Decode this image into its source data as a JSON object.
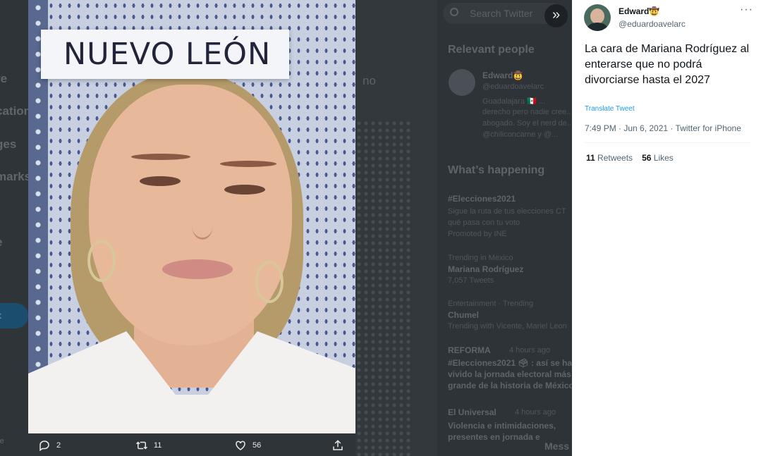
{
  "background": {
    "nav_items": [
      "re",
      "cations",
      "ges",
      "marks",
      "e"
    ],
    "tweet_button_label": "et",
    "partial_text": "no",
    "search_placeholder": "Search Twitter",
    "relevant_people_title": "Relevant people",
    "relevant_user_name": "Edward🤠",
    "relevant_user_handle": "@eduardoavelarc",
    "relevant_user_bio": [
      "Guadalajara 🇲🇽 ...",
      "derecho pero nadie cree...",
      "abogado. Soy el nerd de...",
      "@chiliconcarne y @..."
    ],
    "whats_happening_title": "What’s happening",
    "trends": [
      {
        "title": "#Elecciones2021",
        "desc": "Sigue la ruta de tus elecciones CT",
        "desc2": "qué pasa con tu voto",
        "promo": "Promoted by INE"
      },
      {
        "title": "Mariana Rodríguez",
        "context": "Trending in Mexico",
        "count": "7,057 Tweets"
      },
      {
        "title": "Chumel",
        "context": "Entertainment · Trending",
        "count": "Trending with Vicente, Mariel Leon"
      }
    ],
    "news": [
      {
        "source": "REFORMA",
        "time": "4 hours ago",
        "headline": "#Elecciones2021 🗳 : así se ha vivido la jornada electoral más grande de la historia de México"
      },
      {
        "source": "El Universal",
        "time": "4 hours ago",
        "headline": "Violencia e intimidaciones, presentes en jornada e"
      }
    ],
    "messages_label": "Mess"
  },
  "media": {
    "sign_text": "NUEVO LEÓN",
    "alt": "photo"
  },
  "media_actions": {
    "reply_count": "2",
    "retweet_count": "11",
    "like_count": "56"
  },
  "tweet": {
    "author_name": "Edward🤠",
    "author_handle": "@eduardoavelarc",
    "text": "La cara de Mariana Rodríguez al enterarse que no podrá divorciarse hasta el 2027",
    "translate_label": "Translate Tweet",
    "meta": "7:49 PM · Jun 6, 2021 · Twitter for iPhone",
    "retweets_count": "11",
    "retweets_label": "Retweets",
    "likes_count": "56",
    "likes_label": "Likes"
  }
}
